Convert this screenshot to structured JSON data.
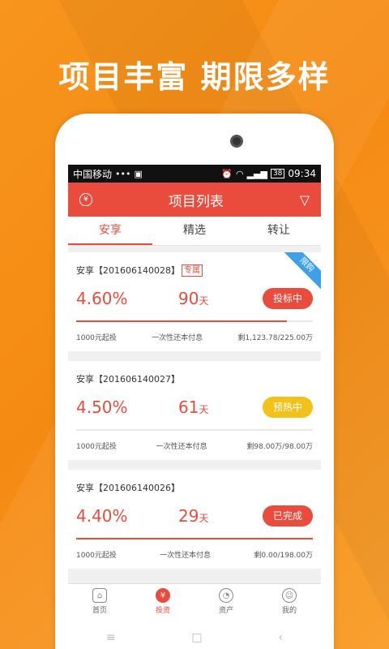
{
  "headline": "项目丰富 期限多样",
  "statusbar": {
    "carrier": "中国移动",
    "dots": "•••",
    "image_icon": "▣",
    "alarm_icon": "⏰",
    "wifi_icon": "◠",
    "signal_icon": "▂▄▆",
    "battery": "38",
    "time": "09:34"
  },
  "titlebar": {
    "title": "项目列表",
    "bag_icon": "¥",
    "filter_icon": "▽"
  },
  "tabs": [
    {
      "label": "安享"
    },
    {
      "label": "精选"
    },
    {
      "label": "转让"
    }
  ],
  "items": [
    {
      "title": "安享【201606140028】",
      "tag": "专属",
      "ribbon": "限购",
      "rate": "4.60%",
      "days": "90",
      "unit": "天",
      "status": "投标中",
      "progress": 0.89,
      "min": "1000元起投",
      "repay": "一次性还本付息",
      "remain": "剩1,123.78/225.00万"
    },
    {
      "title": "安享【201606140027】",
      "rate": "4.50%",
      "days": "61",
      "unit": "天",
      "status": "预热中",
      "progress": 0,
      "min": "1000元起投",
      "repay": "一次性还本付息",
      "remain": "剩98.00万/98.00万"
    },
    {
      "title": "安享【201606140026】",
      "rate": "4.40%",
      "days": "29",
      "unit": "天",
      "status": "已完成",
      "progress": 1.0,
      "min": "1000元起投",
      "repay": "一次性还本付息",
      "remain": "剩0.00/198.00万"
    }
  ],
  "navbar": [
    {
      "label": "首页",
      "icon": "⌂"
    },
    {
      "label": "投资",
      "icon": "¥"
    },
    {
      "label": "资产",
      "icon": "◔"
    },
    {
      "label": "我的",
      "icon": "☺"
    }
  ],
  "softkeys": {
    "menu": "≡",
    "home": "□",
    "back": "‹"
  }
}
